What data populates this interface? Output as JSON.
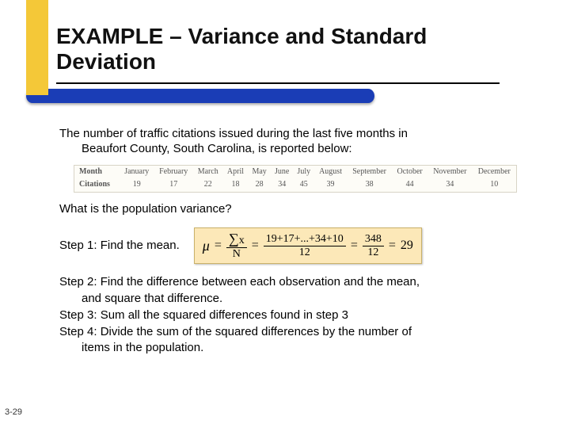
{
  "title": "EXAMPLE – Variance and Standard Deviation",
  "intro_line1": "The number of traffic citations issued during the last five months in",
  "intro_line2": "Beaufort County, South Carolina, is reported below:",
  "table": {
    "row_labels": [
      "Month",
      "Citations"
    ],
    "months": [
      "January",
      "February",
      "March",
      "April",
      "May",
      "June",
      "July",
      "August",
      "September",
      "October",
      "November",
      "December"
    ],
    "citations": [
      "19",
      "17",
      "22",
      "18",
      "28",
      "34",
      "45",
      "39",
      "38",
      "44",
      "34",
      "10"
    ]
  },
  "question": "What is the population variance?",
  "step1_label": "Step 1: Find the mean.",
  "formula": {
    "mu": "μ",
    "eq": "=",
    "sum_sym": "∑",
    "x": "x",
    "N": "N",
    "expansion": "19+17+...+34+10",
    "den12": "12",
    "sum_total": "348",
    "result": "29"
  },
  "step2a": "Step 2: Find the difference between each observation and the mean,",
  "step2b": "and square that difference.",
  "step3": "Step 3: Sum all the squared differences found in step 3",
  "step4a": "Step 4: Divide the sum of the squared differences by the number of",
  "step4b": "items in the population.",
  "slide_number": "3-29"
}
